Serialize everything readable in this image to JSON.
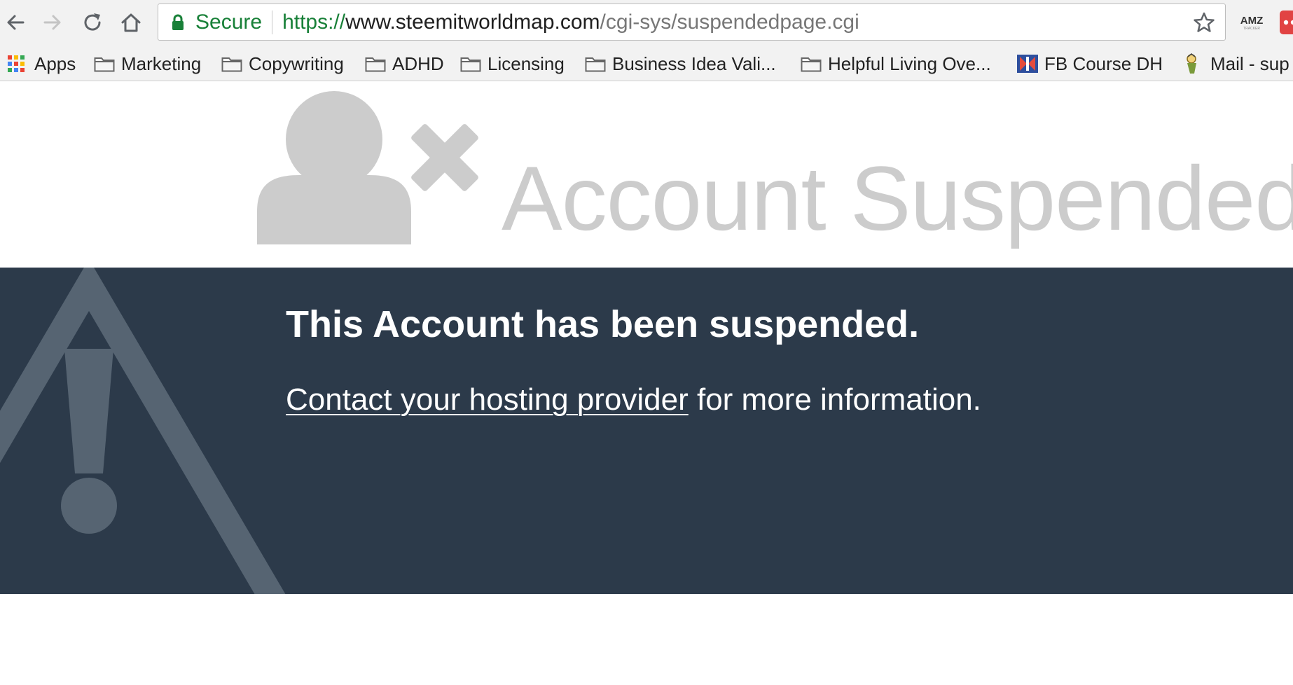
{
  "browser": {
    "security_label": "Secure",
    "url": {
      "scheme": "https://",
      "host": "www.steemitworldmap.com",
      "path": "/cgi-sys/suspendedpage.cgi"
    },
    "extensions": [
      {
        "name": "amz-tracker",
        "text": "AMZ",
        "subtext": "TRACKER"
      },
      {
        "name": "red-extension"
      }
    ]
  },
  "bookmarks": [
    {
      "label": "Apps",
      "icon": "apps-grid-icon"
    },
    {
      "label": "Marketing",
      "icon": "folder-icon"
    },
    {
      "label": "Copywriting",
      "icon": "folder-icon"
    },
    {
      "label": "ADHD",
      "icon": "folder-icon"
    },
    {
      "label": "Licensing",
      "icon": "folder-icon"
    },
    {
      "label": "Business Idea Vali...",
      "icon": "folder-icon"
    },
    {
      "label": "Helpful Living Ove...",
      "icon": "folder-icon"
    },
    {
      "label": "FB Course DH",
      "icon": "site-favicon"
    },
    {
      "label": "Mail - sup",
      "icon": "site-favicon"
    }
  ],
  "page": {
    "heading": "Account Suspended",
    "message_title": "This Account has been suspended.",
    "contact_link": "Contact your hosting provider",
    "contact_suffix": " for more information."
  },
  "colors": {
    "banner_bg": "#2c3a4a",
    "heading_gray": "#cccccc",
    "secure_green": "#188038"
  }
}
